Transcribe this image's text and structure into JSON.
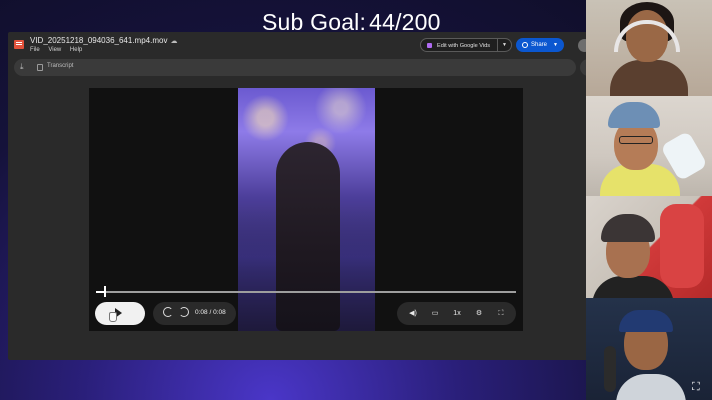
{
  "overlay": {
    "sub_goal_label": "Sub Goal:",
    "sub_goal_value": "44/200"
  },
  "viewer": {
    "file_name": "VID_20251218_094036_641.mp4.mov",
    "menu": [
      "File",
      "View",
      "Help"
    ],
    "edit_button_label": "Edit with Google Vids",
    "share_button_label": "Share",
    "transcript_label": "Transcript"
  },
  "player": {
    "time_display": "0:08 / 0:08",
    "speed_label": "1x",
    "state": "ended",
    "progress_fraction": 0.02
  },
  "icons": {
    "file": "video-file-icon",
    "cloud": "cloud-offline-icon",
    "vids": "google-vids-icon",
    "share": "globe-icon",
    "download": "download-icon",
    "transcript": "transcript-icon",
    "collapse": "chevron-up-icon",
    "play": "play-icon",
    "rewind": "rewind-10-icon",
    "forward": "forward-10-icon",
    "volume": "volume-icon",
    "captions": "captions-icon",
    "settings": "gear-icon",
    "fullscreen": "fullscreen-icon"
  },
  "colors": {
    "share_button": "#0b57d0",
    "vids_accent": "#b06bf2",
    "file_icon": "#e2523b"
  }
}
